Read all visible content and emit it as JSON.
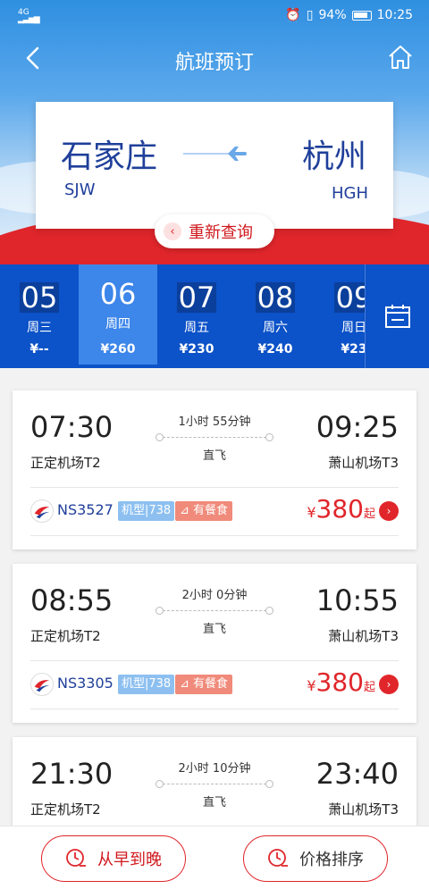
{
  "status_bar": {
    "network": "4G",
    "battery": "94%",
    "time": "10:25"
  },
  "nav": {
    "title": "航班预订"
  },
  "route": {
    "from_city": "石家庄",
    "from_code": "SJW",
    "to_city": "杭州",
    "to_code": "HGH"
  },
  "requery": {
    "label": "重新查询"
  },
  "dates": [
    {
      "day": "05",
      "week": "周三",
      "price": "¥--"
    },
    {
      "day": "06",
      "week": "周四",
      "price": "¥260"
    },
    {
      "day": "07",
      "week": "周五",
      "price": "¥230"
    },
    {
      "day": "08",
      "week": "周六",
      "price": "¥240"
    },
    {
      "day": "09",
      "week": "周日",
      "price": "¥23"
    }
  ],
  "selected_date_index": 1,
  "flights": [
    {
      "dep_time": "07:30",
      "arr_time": "09:25",
      "duration": "1小时 55分钟",
      "type": "直飞",
      "dep_airport": "正定机场T2",
      "arr_airport": "萧山机场T3",
      "flight_no": "NS3527",
      "aircraft": "机型|738",
      "meal": "有餐食",
      "currency": "¥",
      "price": "380",
      "price_suffix": "起"
    },
    {
      "dep_time": "08:55",
      "arr_time": "10:55",
      "duration": "2小时 0分钟",
      "type": "直飞",
      "dep_airport": "正定机场T2",
      "arr_airport": "萧山机场T3",
      "flight_no": "NS3305",
      "aircraft": "机型|738",
      "meal": "有餐食",
      "currency": "¥",
      "price": "380",
      "price_suffix": "起"
    },
    {
      "dep_time": "21:30",
      "arr_time": "23:40",
      "duration": "2小时 10分钟",
      "type": "直飞",
      "dep_airport": "正定机场T2",
      "arr_airport": "萧山机场T3"
    }
  ],
  "sort": {
    "time_label": "从早到晚",
    "price_label": "价格排序"
  },
  "colors": {
    "brand_blue": "#0c52c8",
    "accent_red": "#e0262b",
    "city_blue": "#1f3f9a"
  }
}
